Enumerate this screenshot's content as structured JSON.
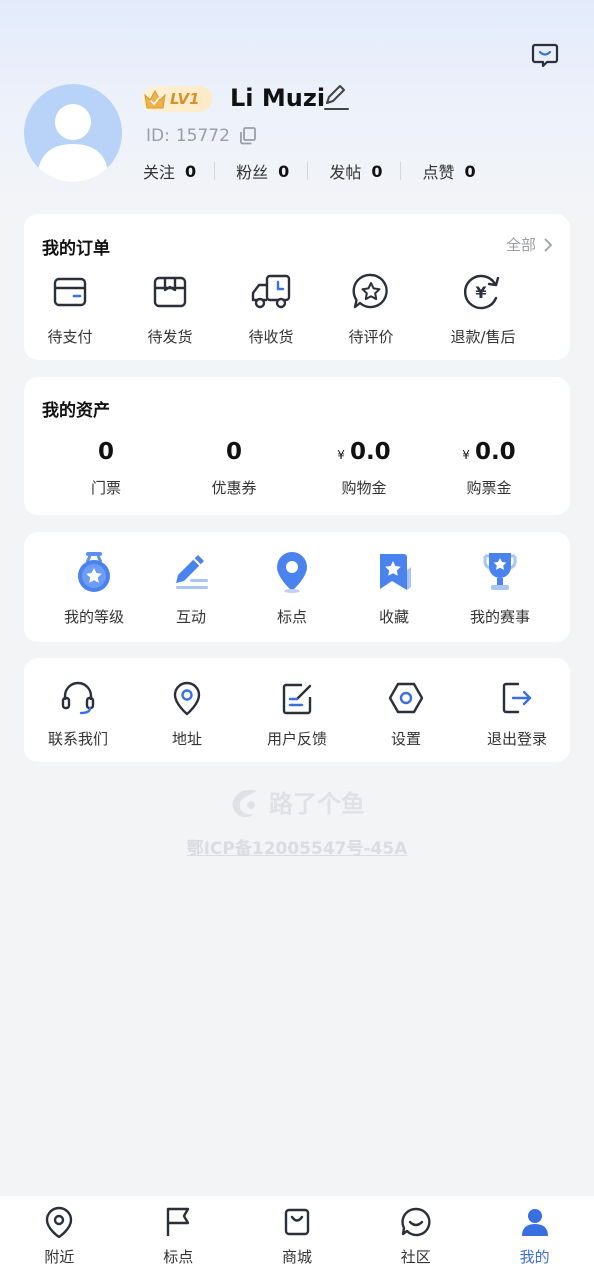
{
  "profile": {
    "level": "LV1",
    "name": "Li Muzi",
    "id_label": "ID:",
    "id_value": "15772",
    "stats": [
      {
        "label": "关注",
        "value": "0"
      },
      {
        "label": "粉丝",
        "value": "0"
      },
      {
        "label": "发帖",
        "value": "0"
      },
      {
        "label": "点赞",
        "value": "0"
      }
    ]
  },
  "orders": {
    "title": "我的订单",
    "all_label": "全部",
    "items": [
      {
        "label": "待支付",
        "icon": "wallet-icon"
      },
      {
        "label": "待发货",
        "icon": "box-icon"
      },
      {
        "label": "待收货",
        "icon": "truck-icon"
      },
      {
        "label": "待评价",
        "icon": "star-bubble-icon"
      },
      {
        "label": "退款/售后",
        "icon": "refund-icon"
      }
    ]
  },
  "assets": {
    "title": "我的资产",
    "currency": "¥",
    "items": [
      {
        "label": "门票",
        "value": "0"
      },
      {
        "label": "优惠券",
        "value": "0"
      },
      {
        "label": "购物金",
        "value": "0.0"
      },
      {
        "label": "购票金",
        "value": "0.0"
      }
    ]
  },
  "features": {
    "items": [
      {
        "label": "我的等级",
        "icon": "medal-icon"
      },
      {
        "label": "互动",
        "icon": "pencil-icon"
      },
      {
        "label": "标点",
        "icon": "map-pin-icon"
      },
      {
        "label": "收藏",
        "icon": "bookmark-star-icon"
      },
      {
        "label": "我的赛事",
        "icon": "trophy-icon"
      }
    ]
  },
  "tools": {
    "items": [
      {
        "label": "联系我们",
        "icon": "headset-icon"
      },
      {
        "label": "地址",
        "icon": "location-icon"
      },
      {
        "label": "用户反馈",
        "icon": "feedback-icon"
      },
      {
        "label": "设置",
        "icon": "settings-hexagon-icon"
      },
      {
        "label": "退出登录",
        "icon": "logout-icon"
      }
    ]
  },
  "footer": {
    "brand": "路了个鱼",
    "icp": "鄂ICP备12005547号-45A"
  },
  "tabbar": {
    "items": [
      {
        "label": "附近",
        "icon": "location-pin-icon"
      },
      {
        "label": "标点",
        "icon": "flag-icon"
      },
      {
        "label": "商城",
        "icon": "shopping-bag-icon"
      },
      {
        "label": "社区",
        "icon": "chat-bubble-icon"
      },
      {
        "label": "我的",
        "icon": "user-icon"
      }
    ],
    "active_color": "#3a6fe0"
  },
  "colors": {
    "accent": "#3a6fe0",
    "badge_gold": "#d8902a"
  }
}
